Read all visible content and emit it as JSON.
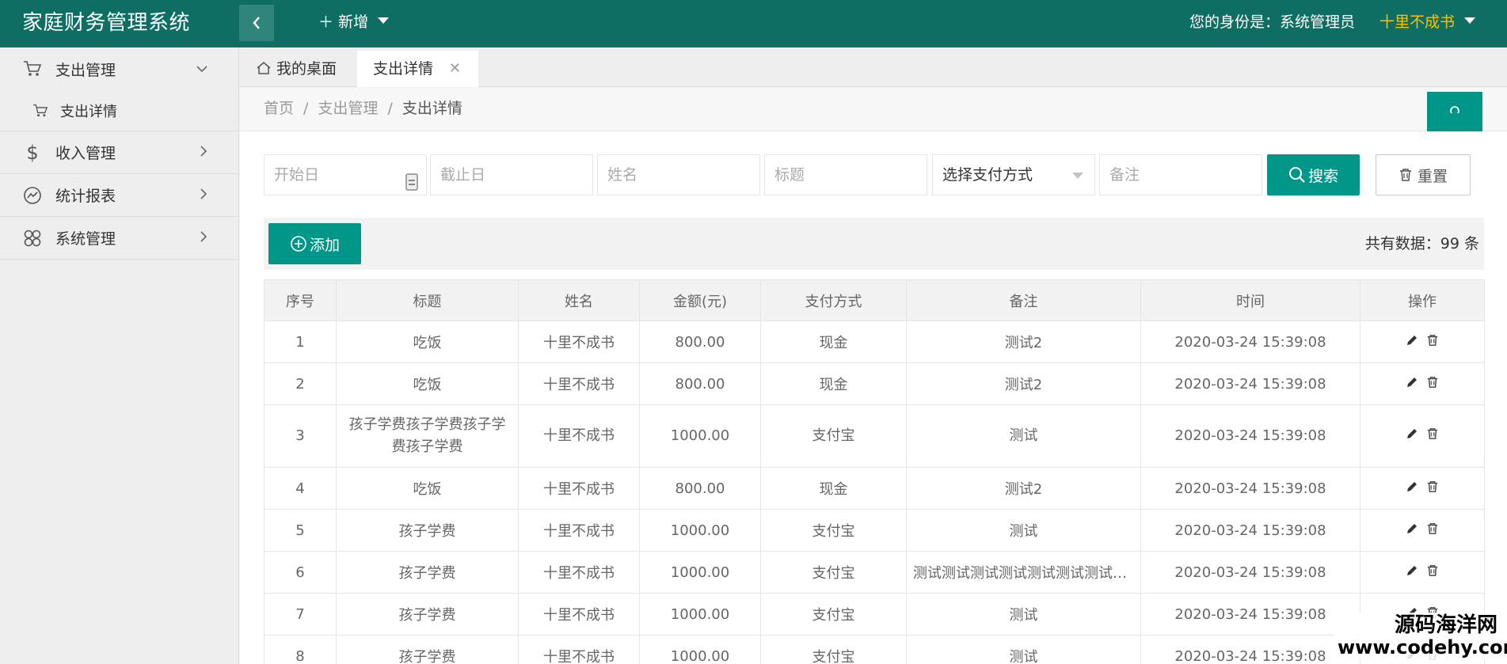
{
  "header": {
    "logo": "家庭财务管理系统",
    "new_label": "新增",
    "identity": "您的身份是：系统管理员",
    "username": "十里不成书",
    "accent": "#0f6e63",
    "username_color": "#f4c30a"
  },
  "sidebar": {
    "items": [
      {
        "label": "支出管理",
        "icon": "cart-icon"
      },
      {
        "label": "收入管理",
        "icon": "dollar-icon"
      },
      {
        "label": "统计报表",
        "icon": "chart-icon"
      },
      {
        "label": "系统管理",
        "icon": "apps-icon"
      }
    ],
    "sub_items": [
      {
        "label": "支出详情",
        "icon": "cart-icon"
      }
    ]
  },
  "tabs": {
    "home": "我的桌面",
    "active": "支出详情"
  },
  "breadcrumb": {
    "home": "首页",
    "section": "支出管理",
    "current": "支出详情"
  },
  "filters": {
    "start_placeholder": "开始日",
    "end_placeholder": "截止日",
    "name_placeholder": "姓名",
    "title_placeholder": "标题",
    "pay_method_selected": "选择支付方式",
    "remark_placeholder": "备注",
    "search_label": "搜索",
    "reset_label": "重置"
  },
  "toolbar": {
    "add_label": "添加",
    "total_text": "共有数据：99 条"
  },
  "table": {
    "columns": [
      "序号",
      "标题",
      "姓名",
      "金额(元)",
      "支付方式",
      "备注",
      "时间",
      "操作"
    ],
    "rows": [
      {
        "no": "1",
        "title": "吃饭",
        "name": "十里不成书",
        "amount": "800.00",
        "method": "现金",
        "remark": "测试2",
        "time": "2020-03-24 15:39:08"
      },
      {
        "no": "2",
        "title": "吃饭",
        "name": "十里不成书",
        "amount": "800.00",
        "method": "现金",
        "remark": "测试2",
        "time": "2020-03-24 15:39:08"
      },
      {
        "no": "3",
        "title": "孩子学费孩子学费孩子学费孩子学费",
        "name": "十里不成书",
        "amount": "1000.00",
        "method": "支付宝",
        "remark": "测试",
        "time": "2020-03-24 15:39:08"
      },
      {
        "no": "4",
        "title": "吃饭",
        "name": "十里不成书",
        "amount": "800.00",
        "method": "现金",
        "remark": "测试2",
        "time": "2020-03-24 15:39:08"
      },
      {
        "no": "5",
        "title": "孩子学费",
        "name": "十里不成书",
        "amount": "1000.00",
        "method": "支付宝",
        "remark": "测试",
        "time": "2020-03-24 15:39:08"
      },
      {
        "no": "6",
        "title": "孩子学费",
        "name": "十里不成书",
        "amount": "1000.00",
        "method": "支付宝",
        "remark": "测试测试测试测试测试测试测试测试",
        "time": "2020-03-24 15:39:08"
      },
      {
        "no": "7",
        "title": "孩子学费",
        "name": "十里不成书",
        "amount": "1000.00",
        "method": "支付宝",
        "remark": "测试",
        "time": "2020-03-24 15:39:08"
      },
      {
        "no": "8",
        "title": "孩子学费",
        "name": "十里不成书",
        "amount": "1000.00",
        "method": "支付宝",
        "remark": "测试",
        "time": "2020-03-24 15:39:08"
      }
    ]
  },
  "watermark": {
    "line1": "源码海洋网",
    "line2": "www.codehy.com"
  }
}
